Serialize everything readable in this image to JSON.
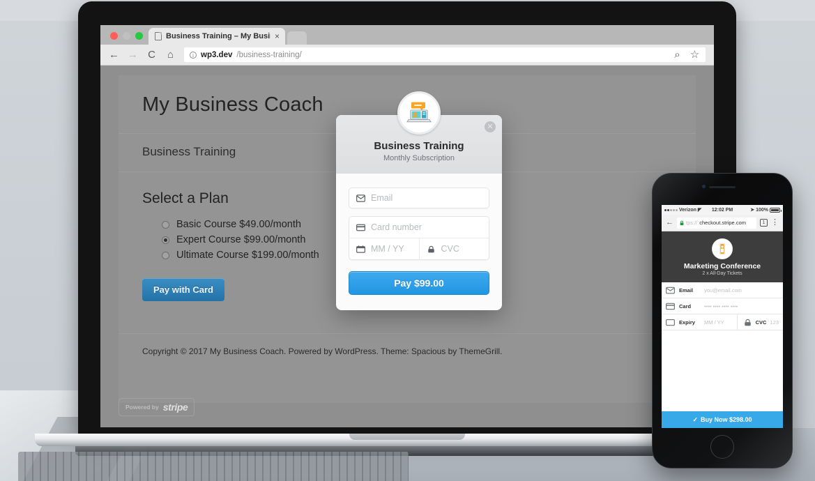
{
  "browser": {
    "tab_title": "Business Training – My Busine",
    "tab_close": "×",
    "back_icon": "←",
    "forward_icon": "→",
    "reload_icon": "C",
    "home_icon": "⌂",
    "url_host": "wp3.dev",
    "url_path": "/business-training/",
    "zoom_icon": "⌕",
    "bookmark_icon": "☆"
  },
  "site": {
    "title": "My Business Coach",
    "breadcrumb": "Business Training",
    "section_heading": "Select a Plan",
    "plans": [
      {
        "label": "Basic Course $49.00/month",
        "selected": false
      },
      {
        "label": "Expert Course $99.00/month",
        "selected": true
      },
      {
        "label": "Ultimate Course $199.00/month",
        "selected": false
      }
    ],
    "pay_with_card_label": "Pay with Card",
    "footer": "Copyright © 2017 My Business Coach. Powered by WordPress. Theme: Spacious by ThemeGrill.",
    "stripe_badge_prefix": "Powered by",
    "stripe_badge_word": "stripe"
  },
  "modal": {
    "title": "Business Training",
    "subtitle": "Monthly Subscription",
    "close_label": "✕",
    "email_placeholder": "Email",
    "card_placeholder": "Card number",
    "expiry_placeholder": "MM / YY",
    "cvc_placeholder": "CVC",
    "pay_button_label": "Pay $99.00",
    "accent_color": "#2196e2"
  },
  "phone": {
    "status": {
      "carrier": "Verizon",
      "wifi_icon": "◤",
      "time": "12:02 PM",
      "location_icon": "➤",
      "battery_pct": "100%"
    },
    "browser": {
      "back_icon": "←",
      "url_scheme": "tps://",
      "url_rest": "checkout.stripe.com",
      "tab_count": "1",
      "menu_icon": "⋮"
    },
    "checkout": {
      "title": "Marketing Conference",
      "subtitle": "2 x All-Day Tickets",
      "rows": [
        {
          "label": "Email",
          "value": "you@email.com"
        },
        {
          "label": "Card",
          "value": "•••• •••• •••• ••••"
        },
        {
          "label": "Expiry",
          "value": "MM / YY",
          "extra_label": "CVC",
          "extra_value": "123"
        }
      ],
      "buy_check": "✓",
      "buy_label": "Buy Now $298.00",
      "accent_color": "#38a9e8"
    }
  }
}
